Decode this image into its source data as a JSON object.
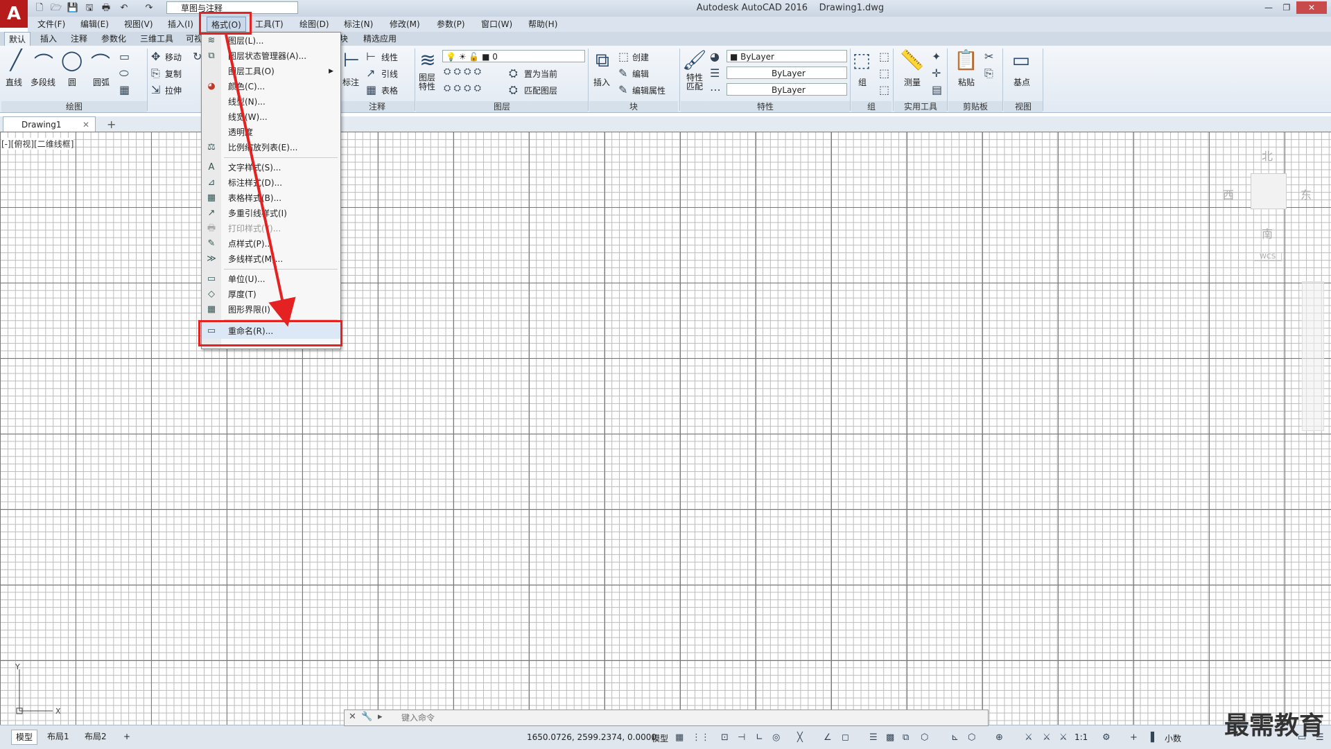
{
  "window": {
    "app_name": "Autodesk AutoCAD 2016",
    "file_name": "Drawing1.dwg",
    "app_logo": "A",
    "workspace": "草图与注释"
  },
  "menubar": [
    "文件(F)",
    "编辑(E)",
    "视图(V)",
    "插入(I)",
    "格式(O)",
    "工具(T)",
    "绘图(D)",
    "标注(N)",
    "修改(M)",
    "参数(P)",
    "窗口(W)",
    "帮助(H)"
  ],
  "ribbon_tabs": [
    "默认",
    "插入",
    "注释",
    "参数化",
    "三维工具",
    "可视",
    "块",
    "精选应用"
  ],
  "ribbon": {
    "draw": {
      "line": "直线",
      "polyline": "多段线",
      "circle": "圆",
      "arc": "圆弧",
      "title": "绘图"
    },
    "modify": {
      "move": "移动",
      "copy": "复制",
      "stretch": "拉伸"
    },
    "annotation": {
      "dimension": "标注",
      "linear": "线性",
      "leader": "引线",
      "table": "表格",
      "title": "注释"
    },
    "layers": {
      "props": "图层\n特性",
      "layer_value": "0",
      "set_current": "置为当前",
      "match": "匹配图层",
      "title": "图层"
    },
    "block": {
      "insert": "插入",
      "create": "创建",
      "edit": "编辑",
      "edit_attr": "编辑属性",
      "title": "块"
    },
    "properties": {
      "match": "特性\n匹配",
      "color": "ByLayer",
      "linetype": "ByLayer",
      "lineweight": "ByLayer",
      "title": "特性"
    },
    "groups": {
      "group": "组",
      "title": "组"
    },
    "utilities": {
      "measure": "测量",
      "title": "实用工具"
    },
    "clipboard": {
      "paste": "粘贴",
      "title": "剪贴板"
    },
    "view": {
      "base": "基点",
      "title": "视图"
    }
  },
  "doc_tab": "Drawing1",
  "viewport_label": "[-][俯视][二维线框]",
  "viewcube": {
    "north": "北",
    "south": "南",
    "east": "东",
    "west": "西",
    "wcs": "WCS"
  },
  "format_menu": [
    {
      "label": "图层(L)...",
      "icon": "layers-icon"
    },
    {
      "label": "图层状态管理器(A)...",
      "icon": "layer-state-icon"
    },
    {
      "label": "图层工具(O)",
      "icon": "",
      "submenu": true
    },
    {
      "label": "颜色(C)...",
      "icon": "color-wheel-icon"
    },
    {
      "label": "线型(N)...",
      "icon": ""
    },
    {
      "label": "线宽(W)...",
      "icon": ""
    },
    {
      "label": "透明度",
      "icon": ""
    },
    {
      "label": "比例缩放列表(E)...",
      "icon": "scale-list-icon"
    },
    {
      "label": "文字样式(S)...",
      "icon": "text-style-icon"
    },
    {
      "label": "标注样式(D)...",
      "icon": "dim-style-icon"
    },
    {
      "label": "表格样式(B)...",
      "icon": "table-style-icon"
    },
    {
      "label": "多重引线样式(I)",
      "icon": "mleader-style-icon"
    },
    {
      "label": "打印样式(Y)...",
      "icon": "plot-style-icon",
      "disabled": true
    },
    {
      "label": "点样式(P)...",
      "icon": "point-style-icon"
    },
    {
      "label": "多线样式(M)...",
      "icon": "mline-style-icon"
    },
    {
      "label": "单位(U)...",
      "icon": "units-icon"
    },
    {
      "label": "厚度(T)",
      "icon": "thickness-icon"
    },
    {
      "label": "图形界限(I)",
      "icon": "limits-icon"
    },
    {
      "label": "重命名(R)...",
      "icon": "rename-icon"
    }
  ],
  "command_line": {
    "placeholder": "键入命令"
  },
  "layout_tabs": [
    "模型",
    "布局1",
    "布局2"
  ],
  "status": {
    "coords": "1650.0726, 2599.2374, 0.0000",
    "space": "模型",
    "scale": "1:1",
    "units": "小数"
  },
  "ucs": {
    "x": "X",
    "y": "Y"
  },
  "watermark": "最需教育",
  "colors": {
    "highlight": "#e52222",
    "logo": "#b71c1c"
  }
}
